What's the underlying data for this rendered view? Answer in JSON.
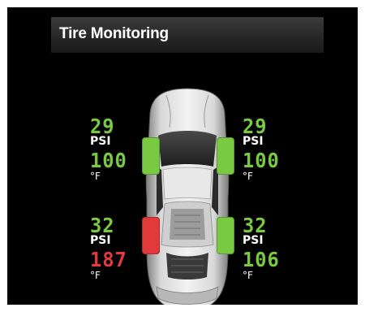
{
  "header": {
    "title": "Tire Monitoring"
  },
  "colors": {
    "ok": "#7ac943",
    "alert": "#e23a3a",
    "text": "#ffffff"
  },
  "tires": {
    "front_left": {
      "pressure": "29",
      "pressure_unit": "PSI",
      "temperature": "100",
      "temperature_unit": "°F",
      "status": "ok"
    },
    "front_right": {
      "pressure": "29",
      "pressure_unit": "PSI",
      "temperature": "100",
      "temperature_unit": "°F",
      "status": "ok"
    },
    "rear_left": {
      "pressure": "32",
      "pressure_unit": "PSI",
      "temperature": "187",
      "temperature_unit": "°F",
      "status": "alert"
    },
    "rear_right": {
      "pressure": "32",
      "pressure_unit": "PSI",
      "temperature": "106",
      "temperature_unit": "°F",
      "status": "ok"
    }
  }
}
